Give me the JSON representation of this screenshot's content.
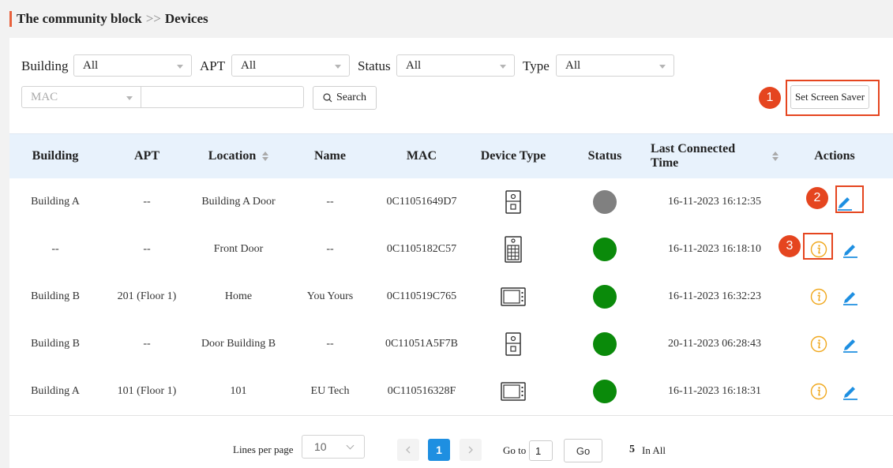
{
  "breadcrumb": {
    "parent": "The community block",
    "separator": ">>",
    "current": "Devices"
  },
  "filters": {
    "building_label": "Building",
    "building_value": "All",
    "apt_label": "APT",
    "apt_value": "All",
    "status_label": "Status",
    "status_value": "All",
    "type_label": "Type",
    "type_value": "All",
    "mac_select": "MAC",
    "mac_input": "",
    "search_label": "Search"
  },
  "set_screen_saver_label": "Set Screen Saver",
  "markers": [
    "1",
    "2",
    "3"
  ],
  "table": {
    "headers": [
      "Building",
      "APT",
      "Location",
      "Name",
      "MAC",
      "Device Type",
      "Status",
      "Last Connected Time",
      "Actions"
    ],
    "rows": [
      {
        "building": "Building A",
        "apt": "--",
        "location": "Building A Door",
        "name": "--",
        "mac": "0C11051649D7",
        "device_type": "door-phone-icon",
        "status": "offline",
        "last_connected": "16-11-2023 16:12:35",
        "actions": [
          "edit-icon"
        ]
      },
      {
        "building": "--",
        "apt": "--",
        "location": "Front Door",
        "name": "--",
        "mac": "0C1105182C57",
        "device_type": "keypad-door-phone-icon",
        "status": "online",
        "last_connected": "16-11-2023 16:18:10",
        "actions": [
          "info-icon",
          "edit-icon"
        ]
      },
      {
        "building": "Building B",
        "apt": "201 (Floor 1)",
        "location": "Home",
        "name": "You Yours",
        "mac": "0C110519C765",
        "device_type": "indoor-monitor-icon",
        "status": "online",
        "last_connected": "16-11-2023 16:32:23",
        "actions": [
          "info-icon",
          "edit-icon"
        ]
      },
      {
        "building": "Building B",
        "apt": "--",
        "location": "Door Building B",
        "name": "--",
        "mac": "0C11051A5F7B",
        "device_type": "door-phone-icon",
        "status": "online",
        "last_connected": "20-11-2023 06:28:43",
        "actions": [
          "info-icon",
          "edit-icon"
        ]
      },
      {
        "building": "Building A",
        "apt": "101 (Floor 1)",
        "location": "101",
        "name": "EU Tech",
        "mac": "0C110516328F",
        "device_type": "indoor-monitor-icon",
        "status": "online",
        "last_connected": "16-11-2023 16:18:31",
        "actions": [
          "info-icon",
          "edit-icon"
        ]
      }
    ]
  },
  "status_colors": {
    "online": "#0a8a0a",
    "offline": "#808080"
  },
  "accent_colors": {
    "marker": "#e5451f",
    "primary": "#1e8fe1",
    "info": "#f0a81e"
  },
  "pagination": {
    "lines_label": "Lines per page",
    "lines_value": "10",
    "current_page": "1",
    "goto_label": "Go to",
    "goto_value": "1",
    "go_label": "Go",
    "total": "5",
    "total_label": "In All"
  }
}
